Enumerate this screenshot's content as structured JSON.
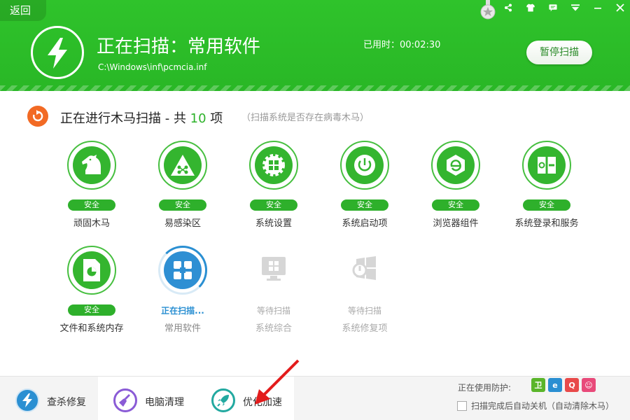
{
  "header": {
    "back_label": "返回",
    "title": "正在扫描：常用软件",
    "path": "C:\\Windows\\inf\\pcmcia.inf",
    "elapsed": "已用时：00:02:30",
    "pause_label": "暂停扫描",
    "bg_color": "#2fc32b"
  },
  "section": {
    "title_prefix": "正在进行木马扫描 - 共 ",
    "count": "10",
    "title_suffix": " 项",
    "hint": "（扫描系统是否存在病毒木马）",
    "icon": "refresh-arrow-icon"
  },
  "items": [
    {
      "label": "顽固木马",
      "status": "安全",
      "state": "safe",
      "icon": "horse-icon"
    },
    {
      "label": "易感染区",
      "status": "安全",
      "state": "safe",
      "icon": "warning-triangle-icon"
    },
    {
      "label": "系统设置",
      "status": "安全",
      "state": "safe",
      "icon": "windows-gear-icon"
    },
    {
      "label": "系统启动项",
      "status": "安全",
      "state": "safe",
      "icon": "power-icon"
    },
    {
      "label": "浏览器组件",
      "status": "安全",
      "state": "safe",
      "icon": "ie-browser-icon"
    },
    {
      "label": "系统登录和服务",
      "status": "安全",
      "state": "safe",
      "icon": "service-panel-icon"
    },
    {
      "label": "文件和系统内存",
      "status": "安全",
      "state": "safe",
      "icon": "file-chart-icon"
    },
    {
      "label": "常用软件",
      "status": "正在扫描...",
      "state": "scanning",
      "icon": "apps-grid-icon"
    },
    {
      "label": "系统综合",
      "status": "等待扫描",
      "state": "waiting",
      "icon": "windows-monitor-icon"
    },
    {
      "label": "系统修复项",
      "status": "等待扫描",
      "state": "waiting",
      "icon": "windows-repair-icon"
    }
  ],
  "bottom": {
    "tabs": [
      {
        "label": "查杀修复",
        "icon": "bolt-icon",
        "color": "#2a8fd2"
      },
      {
        "label": "电脑清理",
        "icon": "broom-icon",
        "color": "#8a5bd6"
      },
      {
        "label": "优化加速",
        "icon": "rocket-icon",
        "color": "#22a9a0"
      }
    ],
    "protect_label": "正在使用防护:",
    "auto_shutdown": "扫描完成后自动关机（自动清除木马）"
  },
  "colors": {
    "safe_green": "#2eb02b",
    "scanning_blue": "#2a8fd2",
    "accent_orange": "#f26a24"
  }
}
